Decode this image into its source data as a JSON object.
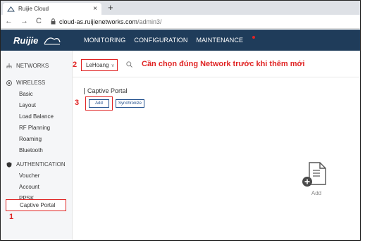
{
  "browser": {
    "tab_title": "Ruijie Cloud",
    "tab_close": "×",
    "new_tab": "+",
    "nav_back": "←",
    "nav_forward": "→",
    "nav_reload": "C",
    "url_host": "cloud-as.ruijienetworks.com",
    "url_path": "/admin3/"
  },
  "header": {
    "nav": [
      "MONITORING",
      "CONFIGURATION",
      "MAINTENANCE"
    ]
  },
  "sidebar": {
    "networks": "NETWORKS",
    "wireless": "WIRELESS",
    "wireless_items": [
      "Basic",
      "Layout",
      "Load Balance",
      "RF Planning",
      "Roaming",
      "Bluetooth"
    ],
    "authentication": "AUTHENTICATION",
    "auth_items": [
      "Voucher",
      "Account",
      "PPSK"
    ],
    "active_item": "Captive Portal"
  },
  "toolbar": {
    "network_value": "LeHoang",
    "chevron": "∨",
    "annotation": "Cần chọn đúng Network trước khi thêm mới"
  },
  "content": {
    "section_title": "Captive Portal",
    "add_button": "Add",
    "sync_button": "Synchronize",
    "empty_add_label": "Add"
  },
  "markers": [
    "1",
    "2",
    "3"
  ],
  "colors": {
    "header_bg": "#1f3c5a",
    "highlight": "#e02424",
    "button_border": "#1f4e8c"
  }
}
